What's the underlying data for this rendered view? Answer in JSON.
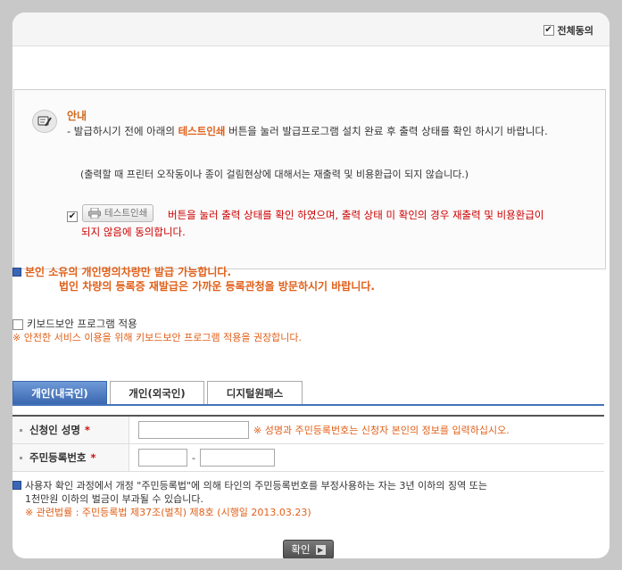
{
  "agree_all": {
    "label": "전체동의",
    "checked": true
  },
  "notice": {
    "title": "안내",
    "line1_pre": "- 발급하시기 전에 아래의 ",
    "line1_highlight": "테스트인쇄",
    "line1_post": " 버튼을 눌러 발급프로그램 설치 완료 후 출력 상태를 확인 하시기 바랍니다.",
    "sub": "(출력할 때 프린터 오작동이나 종이 걸림현상에 대해서는 재출력 및 비용환급이 되지 않습니다.)",
    "test_button_label": "테스트인쇄",
    "test_confirm_text1": "버튼을 눌러 출력 상태를 확인 하였으며, 출력 상태 미 확인의 경우 재출력 및 비용환급이",
    "test_confirm_text2": "되지 않음에 동의합니다."
  },
  "warning": {
    "line1": "본인 소유의 개인명의차량만 발급 가능합니다.",
    "line2": "법인 차량의 등록증 재발급은 가까운 등록관청을 방문하시기 바랍니다."
  },
  "keyboard_security": {
    "label": "키보드보안 프로그램 적용",
    "note": "※ 안전한 서비스 이용을 위해 키보드보안 프로그램 적용을 권장합니다.",
    "checked": false
  },
  "tabs": [
    {
      "label": "개인(내국인)",
      "active": true
    },
    {
      "label": "개인(외국인)",
      "active": false
    },
    {
      "label": "디지털원패스",
      "active": false
    }
  ],
  "form": {
    "name_label": "신청인 성명",
    "name_required": "*",
    "name_note": "※ 성명과 주민등록번호는 신청자 본인의 정보를 입력하십시오.",
    "id_label": "주민등록번호",
    "id_required": "*",
    "id_separator": "-"
  },
  "legal": {
    "line1": "사용자 확인 과정에서 개정 \"주민등록법\"에 의해 타인의 주민등록번호를 부정사용하는 자는 3년 이하의 징역 또는",
    "line2": "1천만원 이하의 벌금이 부과될 수 있습니다.",
    "line3": "※ 관련법률 : 주민등록법 제37조(벌칙) 제8호 (시행일 2013.03.23)"
  },
  "confirm_button": "확인",
  "colors": {
    "accent": "#4573b8",
    "warning": "#e0601a",
    "danger": "#cc0000"
  }
}
